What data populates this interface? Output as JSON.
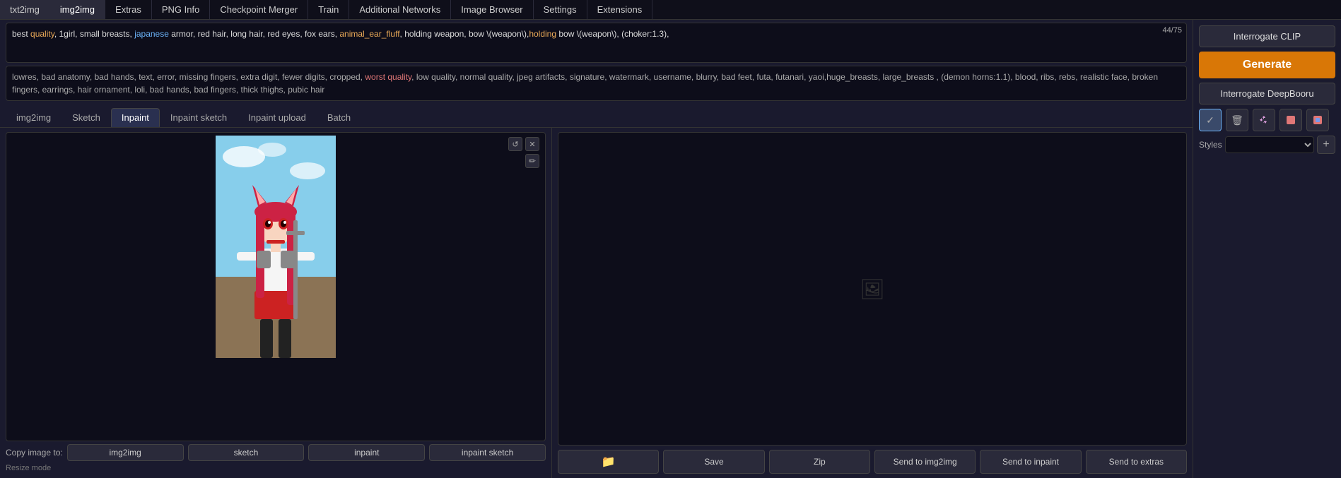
{
  "nav": {
    "items": [
      {
        "label": "txt2img",
        "active": false
      },
      {
        "label": "img2img",
        "active": true
      },
      {
        "label": "Extras",
        "active": false
      },
      {
        "label": "PNG Info",
        "active": false
      },
      {
        "label": "Checkpoint Merger",
        "active": false
      },
      {
        "label": "Train",
        "active": false
      },
      {
        "label": "Additional Networks",
        "active": false
      },
      {
        "label": "Image Browser",
        "active": false
      },
      {
        "label": "Settings",
        "active": false
      },
      {
        "label": "Extensions",
        "active": false
      }
    ]
  },
  "prompt": {
    "counter": "44/75",
    "positive": "best quality, 1girl, small breasts, japanese armor, red hair, long hair, red eyes, fox ears, animal_ear_fluff, holding weapon, bow \\(weapon\\),holding bow \\(weapon\\), (choker:1.3),",
    "negative": "lowres, bad anatomy, bad hands, text, error, missing fingers, extra digit, fewer digits, cropped, worst quality, low quality, normal quality, jpeg artifacts, signature, watermark, username, blurry, bad feet, futa, futanari, yaoi,huge_breasts, large_breasts , (demon horns:1.1), blood, ribs, rebs, realistic face, broken fingers, earrings, hair ornament, loli, bad hands, bad fingers, thick thighs, pubic hair"
  },
  "tabs": [
    {
      "label": "img2img",
      "active": false
    },
    {
      "label": "Sketch",
      "active": false
    },
    {
      "label": "Inpaint",
      "active": true
    },
    {
      "label": "Inpaint sketch",
      "active": false
    },
    {
      "label": "Inpaint upload",
      "active": false
    },
    {
      "label": "Batch",
      "active": false
    }
  ],
  "canvas": {
    "undo_icon": "↺",
    "close_icon": "✕",
    "brush_icon": "✏"
  },
  "copy_to": {
    "label": "Copy image to:",
    "buttons": [
      {
        "label": "img2img"
      },
      {
        "label": "sketch"
      },
      {
        "label": "inpaint"
      },
      {
        "label": "inpaint sketch"
      }
    ]
  },
  "resize_label": "Resize mode",
  "output": {
    "placeholder_icon": "🖼",
    "buttons": [
      {
        "label": "📁",
        "key": "folder"
      },
      {
        "label": "Save",
        "key": "save"
      },
      {
        "label": "Zip",
        "key": "zip"
      },
      {
        "label": "Send to img2img",
        "key": "send-img2img"
      },
      {
        "label": "Send to inpaint",
        "key": "send-inpaint"
      },
      {
        "label": "Send to extras",
        "key": "send-extras"
      }
    ]
  },
  "right_panel": {
    "interrogate_clip_label": "Interrogate CLIP",
    "interrogate_deepbooru_label": "Interrogate DeepBooru",
    "generate_label": "Generate",
    "icon_buttons": [
      {
        "icon": "✓",
        "key": "check",
        "active": true
      },
      {
        "icon": "🗑",
        "key": "trash",
        "active": false
      },
      {
        "icon": "♻",
        "key": "recycle",
        "active": false
      },
      {
        "icon": "⬛",
        "key": "black",
        "active": false
      },
      {
        "icon": "⬜",
        "key": "white",
        "active": false
      }
    ],
    "styles_label": "Styles",
    "styles_placeholder": ""
  }
}
